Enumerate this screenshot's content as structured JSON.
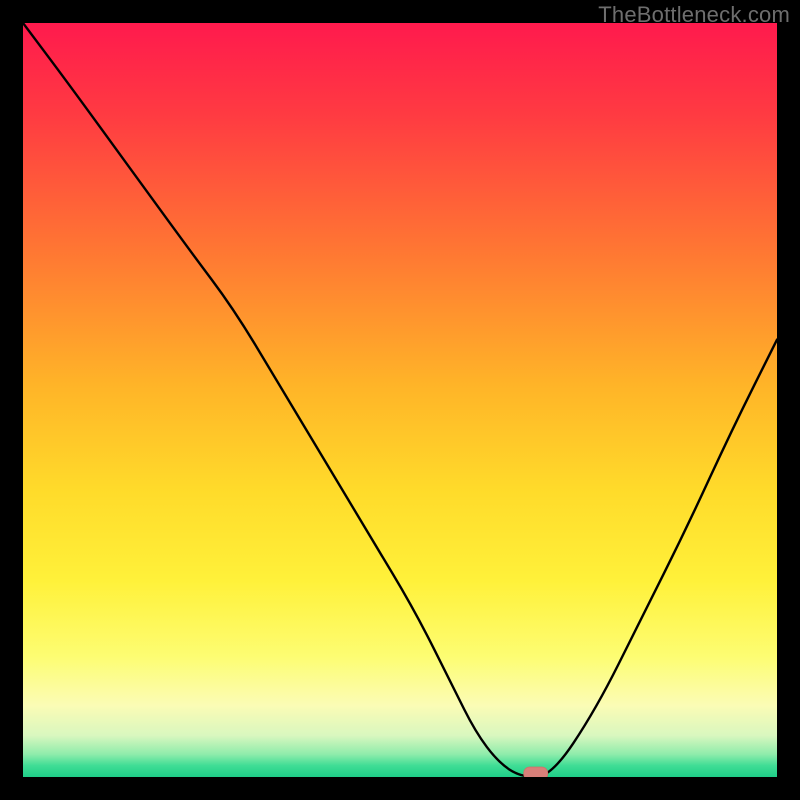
{
  "watermark": "TheBottleneck.com",
  "colors": {
    "frame": "#000000",
    "curve": "#000000",
    "marker_fill": "#d77f79",
    "marker_stroke": "#cf6f68",
    "gradient_stops": [
      {
        "offset": 0.0,
        "color": "#ff1a4d"
      },
      {
        "offset": 0.12,
        "color": "#ff3a42"
      },
      {
        "offset": 0.3,
        "color": "#ff7633"
      },
      {
        "offset": 0.48,
        "color": "#ffb428"
      },
      {
        "offset": 0.62,
        "color": "#ffdb2a"
      },
      {
        "offset": 0.74,
        "color": "#fff13a"
      },
      {
        "offset": 0.84,
        "color": "#fdfd72"
      },
      {
        "offset": 0.905,
        "color": "#fbfcb5"
      },
      {
        "offset": 0.945,
        "color": "#d9f7bf"
      },
      {
        "offset": 0.97,
        "color": "#8eecab"
      },
      {
        "offset": 0.985,
        "color": "#3fdd95"
      },
      {
        "offset": 1.0,
        "color": "#1fce88"
      }
    ]
  },
  "chart_data": {
    "type": "line",
    "title": "",
    "xlabel": "",
    "ylabel": "",
    "xlim": [
      0,
      100
    ],
    "ylim": [
      0,
      100
    ],
    "series": [
      {
        "name": "bottleneck-curve",
        "x": [
          0,
          6,
          14,
          22,
          28,
          34,
          40,
          46,
          52,
          57,
          60,
          63,
          66,
          70,
          76,
          82,
          88,
          94,
          100
        ],
        "values": [
          100,
          92,
          81,
          70,
          62,
          52,
          42,
          32,
          22,
          12,
          6,
          2,
          0,
          0,
          9,
          21,
          33,
          46,
          58
        ]
      }
    ],
    "marker": {
      "x": 68,
      "y": 0
    },
    "note": "Values are percentages read off the plot area (0,0 at bottom-left). Curve is the black V-shaped line; marker is the small pink lozenge at the valley floor."
  }
}
